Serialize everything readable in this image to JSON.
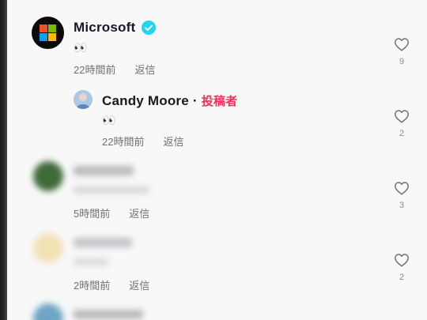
{
  "comments": [
    {
      "author": "Microsoft",
      "verified": true,
      "text": "👀",
      "time": "22時間前",
      "reply_label": "返信",
      "like_count": "9"
    },
    {
      "author": "Candy Moore",
      "separator": "·",
      "author_badge": "投稿者",
      "text": "👀",
      "time": "22時間前",
      "reply_label": "返信",
      "like_count": "2"
    },
    {
      "author": "",
      "text": "",
      "time": "5時間前",
      "reply_label": "返信",
      "like_count": "3"
    },
    {
      "author": "",
      "text": "",
      "time": "2時間前",
      "reply_label": "返信",
      "like_count": "2"
    }
  ],
  "colors": {
    "verified_badge": "#20d5ec",
    "author_badge": "#fe2c55",
    "ms_red": "#f25022",
    "ms_green": "#7fba00",
    "ms_blue": "#00a4ef",
    "ms_yellow": "#ffb900"
  },
  "icons": {
    "like": "heart-outline-icon",
    "verified": "verified-check-icon"
  }
}
